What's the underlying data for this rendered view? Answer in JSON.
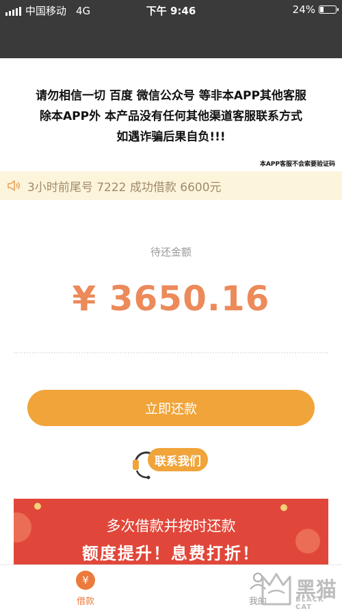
{
  "status_bar": {
    "carrier": "中国移动",
    "network": "4G",
    "time": "下午 9:46",
    "battery_text": "24%",
    "battery_level": 0.24
  },
  "warning": {
    "lines": [
      "请勿相信一切 百度 微信公众号 等非本APP其他客服",
      "除本APP外 本产品没有任何其他渠道客服联系方式",
      "如遇诈骗后果自负!!!"
    ],
    "note": "本APP客服不会索要验证码"
  },
  "ticker": {
    "text": "3小时前尾号 7222 成功借款 6600元"
  },
  "repayment": {
    "label": "待还金额",
    "amount": "¥ 3650.16",
    "button_label": "立即还款"
  },
  "contact": {
    "label": "联系我们"
  },
  "banner": {
    "line1": "多次借款并按时还款",
    "line2": "额度提升！息费打折！"
  },
  "tab_bar": {
    "loan": {
      "icon": "yen-icon",
      "symbol": "¥",
      "label": "借款"
    },
    "mine": {
      "icon": "user-icon",
      "label": "我的"
    }
  },
  "watermark": {
    "cn": "黑猫",
    "en": "BLACK CAT"
  },
  "colors": {
    "accent": "#f0a43a",
    "amount": "#ec8a5a",
    "tab_active": "#ec7a3c",
    "banner": "#e0473a",
    "header": "#3a3a3a"
  }
}
